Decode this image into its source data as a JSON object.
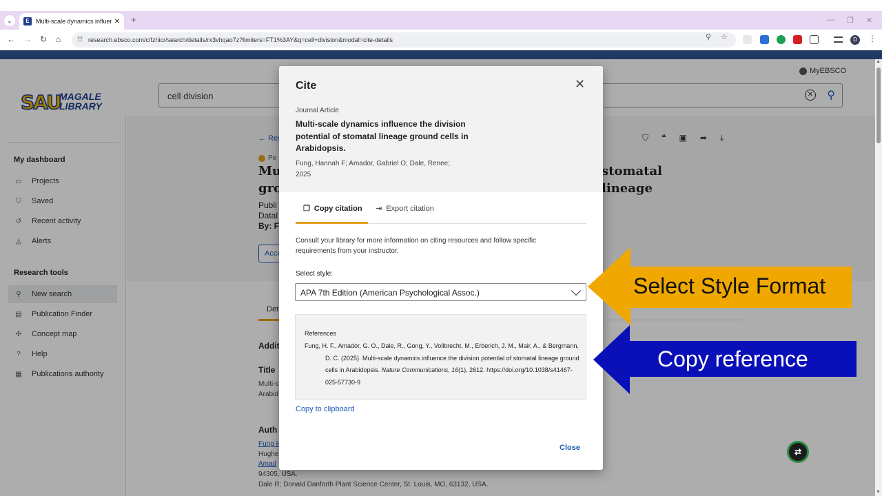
{
  "browser": {
    "tab_title": "Multi-scale dynamics influence",
    "url": "research.ebsco.com/c/fzhicr/search/details/rx3vhqao7z?limiters=FT1%3AY&q=cell+division&modal=cite-details"
  },
  "header": {
    "account_label": "MyEBSCO",
    "logo_letters": "SAU",
    "logo_line1": "MAGALE",
    "logo_line2": "LIBRARY",
    "search_value": "cell division"
  },
  "sidebar": {
    "dashboard_heading": "My dashboard",
    "dashboard_items": [
      {
        "label": "Projects",
        "icon": "folder-icon"
      },
      {
        "label": "Saved",
        "icon": "bookmark-icon"
      },
      {
        "label": "Recent activity",
        "icon": "history-icon"
      },
      {
        "label": "Alerts",
        "icon": "bell-icon"
      }
    ],
    "tools_heading": "Research tools",
    "tools_items": [
      {
        "label": "New search",
        "icon": "search-icon"
      },
      {
        "label": "Publication Finder",
        "icon": "document-icon"
      },
      {
        "label": "Concept map",
        "icon": "concept-map-icon"
      },
      {
        "label": "Help",
        "icon": "help-icon"
      },
      {
        "label": "Publications authority",
        "icon": "list-icon"
      }
    ]
  },
  "article": {
    "back": "Res",
    "peer": "Pe",
    "title_visible_1": "Mul",
    "title_visible_2": "gro",
    "title_right": "stomatal lineage",
    "meta": [
      "Publi",
      "Datal",
      "By: Fu"
    ],
    "access_btn": "Acce",
    "tab_detail": "Det",
    "section_additional": "Addit",
    "section_title": "Title",
    "title_text_1": "Multi-s",
    "title_text_2": "Arabid",
    "section_authors": "Auth",
    "author_1": "Fung H",
    "author_1_aff": "Hughe",
    "author_2": "Amad",
    "author_2_aff": "94305, USA.",
    "author_3_partial": "Dale R; Donald Danforth Plant Science Center, St. Louis, MO, 63132, USA."
  },
  "modal": {
    "title": "Cite",
    "doc_type": "Journal Article",
    "doc_title": "Multi-scale dynamics influence the division potential of stomatal lineage ground cells in Arabidopsis.",
    "authors": "Fung, Hannah F; Amador, Gabriel O; Dale, Renee;",
    "year": "2025",
    "tab_copy": "Copy citation",
    "tab_export": "Export citation",
    "consult": "Consult your library for more information on citing resources and follow specific requirements from your instructor.",
    "style_label": "Select style:",
    "style_value": "APA 7th Edition (American Psychological Assoc.)",
    "ref_heading": "References",
    "ref_part1": "Fung, H. F., Amador, G. O., Dale, R., Gong, Y., Vollbrecht, M., Erberich, J. M., Mair, A., & Bergmann, D. C. (2025). Multi-scale dynamics influence the division potential of stomatal lineage ground cells in Arabidopsis. ",
    "ref_journal": "Nature Communications",
    "ref_sep": ", ",
    "ref_volume": "16",
    "ref_part2": "(1), 2612. https://doi.org/10.1038/s41467-025-57730-9",
    "copy_clipboard": "Copy to clipboard",
    "close": "Close"
  },
  "callouts": {
    "style": {
      "text": "Select Style Format",
      "color": "#f0a800",
      "text_color": "#111111"
    },
    "copy": {
      "text": "Copy reference",
      "color": "#0a10b8",
      "text_color": "#ffffff"
    }
  },
  "colors": {
    "accent": "#e0a020",
    "link": "#1d5ab5",
    "brand_bar": "#1f3a63"
  }
}
